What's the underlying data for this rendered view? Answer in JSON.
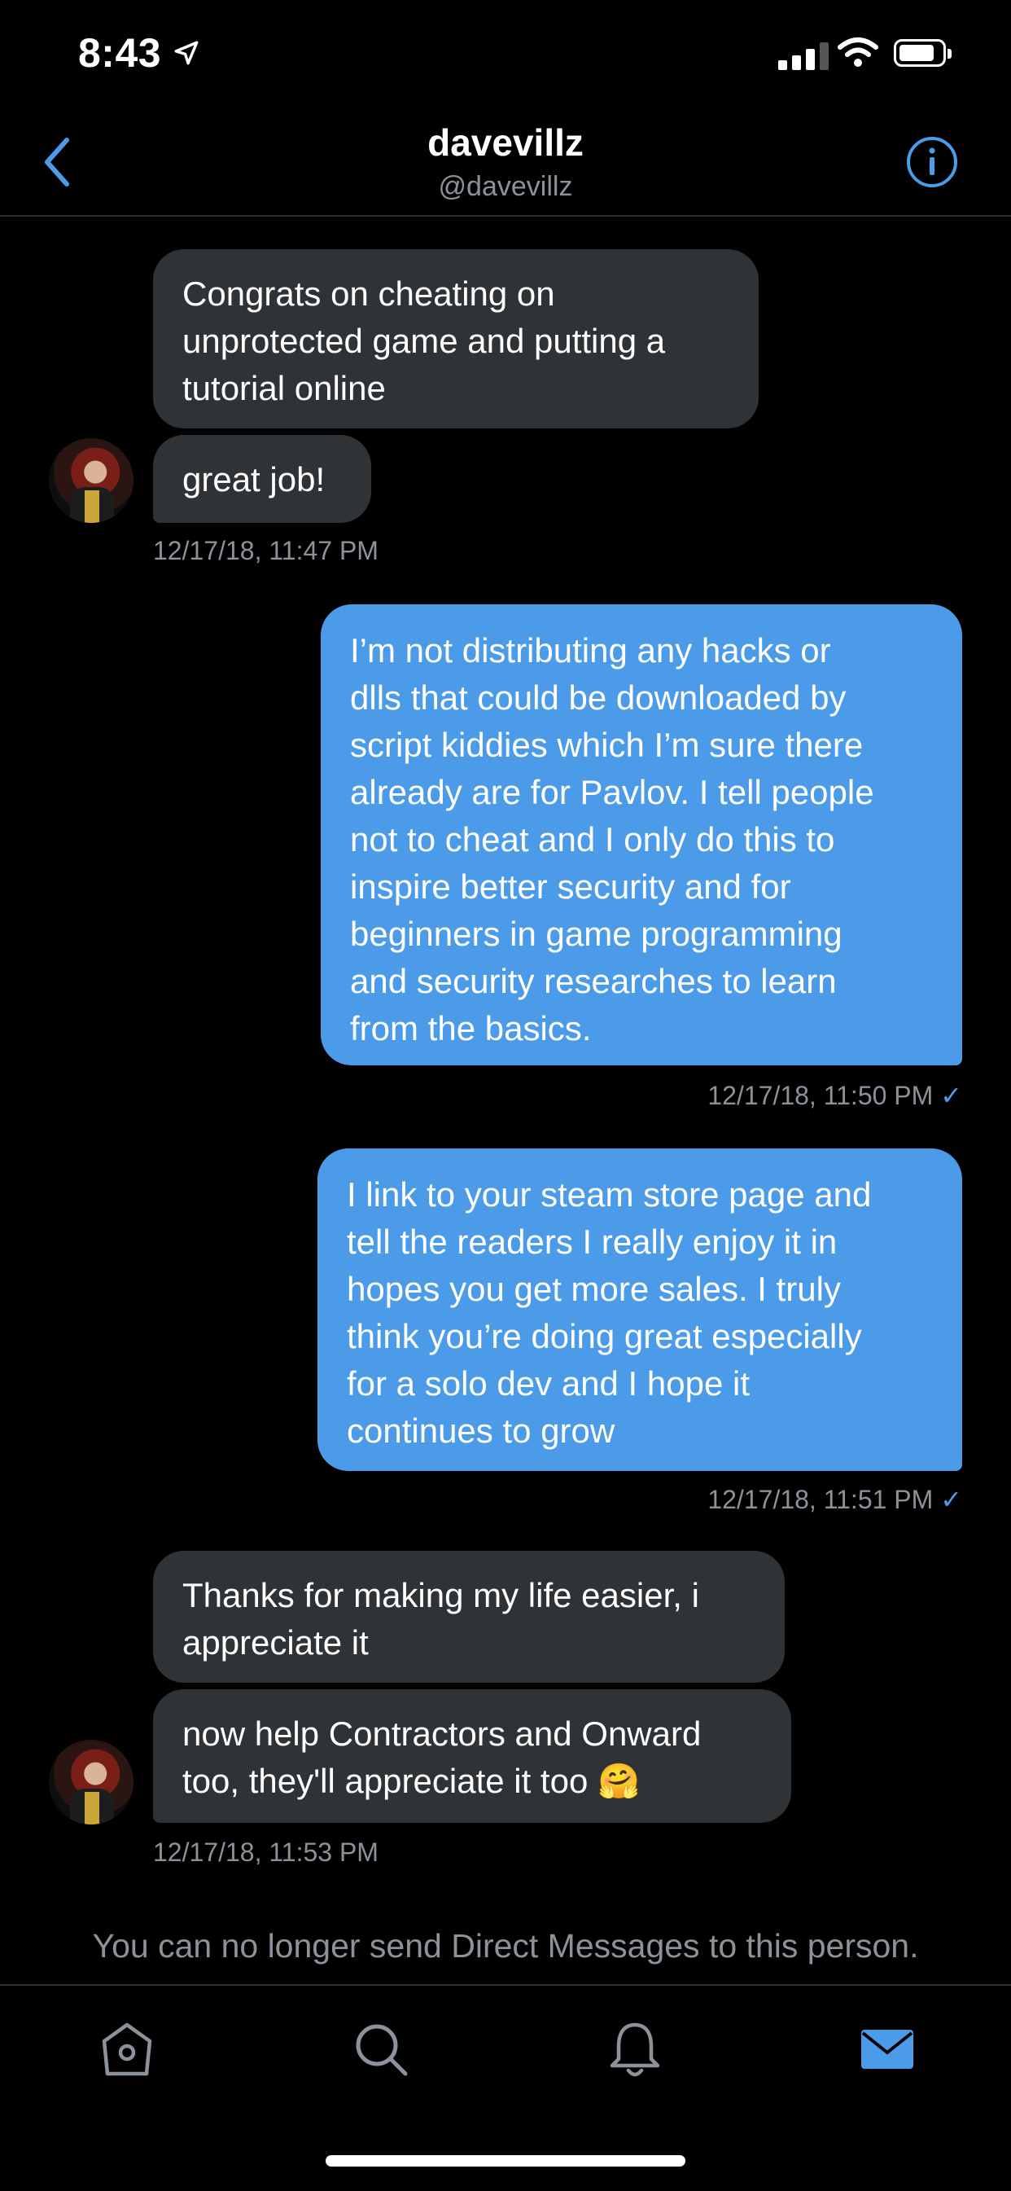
{
  "status_bar": {
    "time": "8:43"
  },
  "header": {
    "title": "davevillz",
    "handle": "@davevillz"
  },
  "messages": [
    {
      "side": "received",
      "text": "Congrats on cheating on\nunprotected game and putting a\ntutorial online"
    },
    {
      "side": "received",
      "text": "great job!"
    },
    {
      "side": "received",
      "timestamp": "12/17/18, 11:47 PM"
    },
    {
      "side": "sent",
      "text": "I’m not distributing any hacks or\ndlls that could be downloaded by\nscript kiddies which I’m sure there\nalready are for Pavlov. I tell people\nnot to cheat and I only do this to\ninspire better security and for\nbeginners in game programming\nand security researches to learn\nfrom the basics.",
      "timestamp": "12/17/18, 11:50 PM"
    },
    {
      "side": "sent",
      "text": "I link to your steam store page and\ntell the readers I really enjoy it in\nhopes you get more sales. I truly\nthink you’re doing great especially\nfor a solo dev and I hope it\ncontinues to grow",
      "timestamp": "12/17/18, 11:51 PM"
    },
    {
      "side": "received",
      "text": "Thanks for making my life easier, i\nappreciate it"
    },
    {
      "side": "received",
      "text": "now help Contractors and Onward\ntoo, they'll appreciate it too 🤗",
      "timestamp": "12/17/18, 11:53 PM"
    }
  ],
  "read_check": "✓",
  "notice": "You can no longer send Direct Messages to this person.",
  "tab_bar": [
    "home-icon",
    "search-icon",
    "notifications-icon",
    "messages-icon"
  ],
  "colors": {
    "accent": "#4c9be8",
    "received_bubble": "#2f3336",
    "background": "#000000",
    "muted_text": "#8b9299"
  }
}
